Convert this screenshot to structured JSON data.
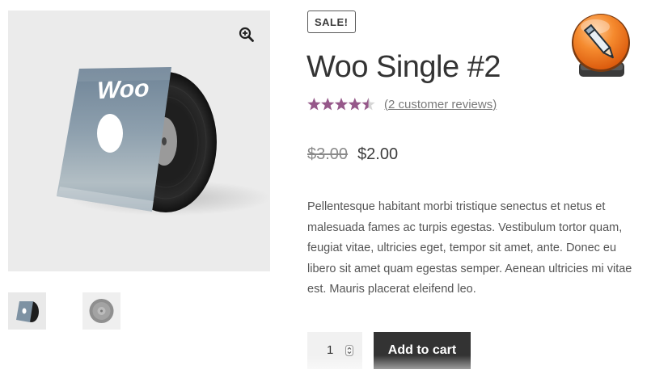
{
  "product": {
    "badge": "SALE!",
    "title": "Woo Single #2",
    "rating": 4.5,
    "rating_max": 5,
    "reviews_link": "(2 customer reviews)",
    "price_old": "$3.00",
    "price_new": "$2.00",
    "description": "Pellentesque habitant morbi tristique senectus et netus et malesuada fames ac turpis egestas. Vestibulum tortor quam, feugiat vitae, ultricies eget, tempor sit amet, ante. Donec eu libero sit amet quam egestas semper. Aenean ultricies mi vitae est. Mauris placerat eleifend leo."
  },
  "gallery": {
    "cover_text": "Woo",
    "zoom_icon": "zoom-in-icon",
    "thumbnails": [
      "vinyl-cover-thumbnail",
      "vinyl-record-thumbnail"
    ]
  },
  "cart": {
    "quantity": "1",
    "add_label": "Add to cart"
  },
  "colors": {
    "star": "#96588a",
    "button_bg": "#333333",
    "button_text": "#ffffff",
    "qty_bg": "#f1f1f1",
    "app_icon_orange": "#f07a1e"
  },
  "icons": {
    "corner_app": "pencil-app-icon",
    "quantity_spinner": "spinner-icon"
  }
}
